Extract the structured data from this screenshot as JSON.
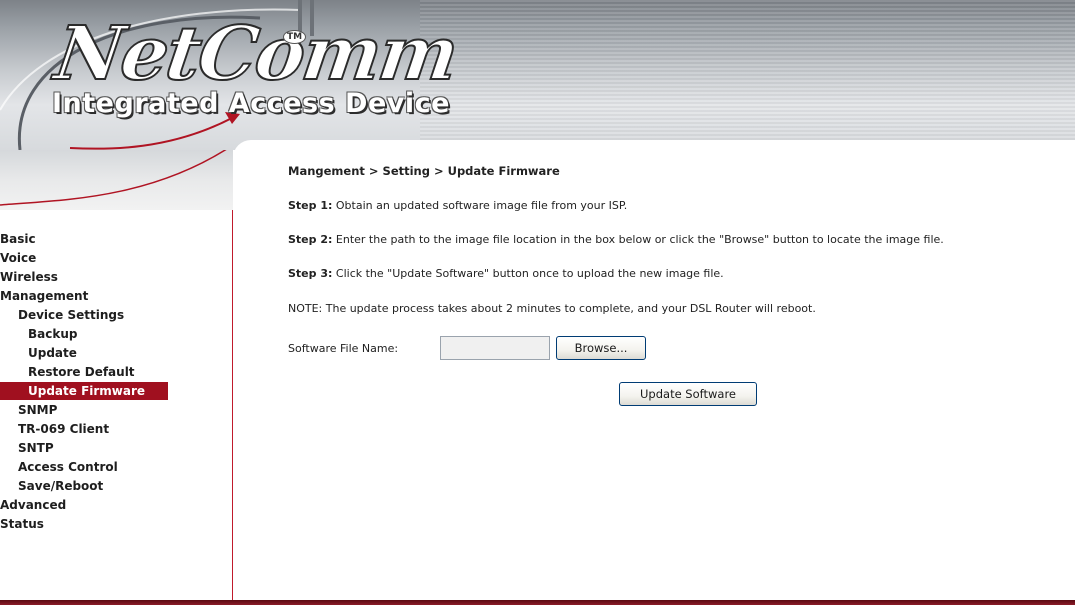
{
  "header": {
    "brand": "NetComm",
    "trademark": "TM",
    "product": "Integrated Access Device"
  },
  "sidebar": {
    "items": [
      {
        "label": "Basic",
        "level": 0,
        "active": false
      },
      {
        "label": "Voice",
        "level": 0,
        "active": false
      },
      {
        "label": "Wireless",
        "level": 0,
        "active": false
      },
      {
        "label": "Management",
        "level": 0,
        "active": false
      },
      {
        "label": "Device Settings",
        "level": 1,
        "active": false
      },
      {
        "label": "Backup",
        "level": 2,
        "active": false
      },
      {
        "label": "Update",
        "level": 2,
        "active": false
      },
      {
        "label": "Restore Default",
        "level": 2,
        "active": false
      },
      {
        "label": "Update Firmware",
        "level": 2,
        "active": true
      },
      {
        "label": "SNMP",
        "level": 1,
        "active": false
      },
      {
        "label": "TR-069 Client",
        "level": 1,
        "active": false
      },
      {
        "label": "SNTP",
        "level": 1,
        "active": false
      },
      {
        "label": "Access Control",
        "level": 1,
        "active": false
      },
      {
        "label": "Save/Reboot",
        "level": 1,
        "active": false
      },
      {
        "label": "Advanced",
        "level": 0,
        "active": false
      },
      {
        "label": "Status",
        "level": 0,
        "active": false
      }
    ]
  },
  "main": {
    "breadcrumb": "Mangement > Setting > Update Firmware",
    "steps": [
      {
        "label": "Step 1:",
        "text": " Obtain an updated software image file from your ISP."
      },
      {
        "label": "Step 2:",
        "text": " Enter the path to the image file location in the box below or click the \"Browse\" button to locate the image file."
      },
      {
        "label": "Step 3:",
        "text": " Click the \"Update Software\" button once to upload the new image file."
      }
    ],
    "note": "NOTE: The update process takes about 2 minutes to complete, and your DSL Router will reboot.",
    "file_label": "Software File Name:",
    "file_value": "",
    "browse_label": "Browse...",
    "update_label": "Update Software"
  },
  "colors": {
    "active_nav_bg": "#a0101f",
    "sidebar_border": "#c01a2c",
    "button_border": "#003c74"
  }
}
